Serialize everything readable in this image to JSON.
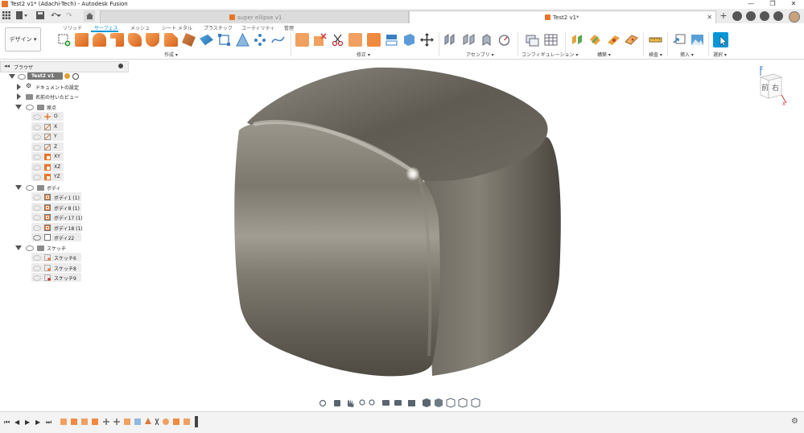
{
  "window": {
    "title": "Test2 v1* (Adachi-Tech) - Autodesk Fusion",
    "controls": [
      "—",
      "❐",
      "✕"
    ]
  },
  "tabs": [
    {
      "label": "super ellipse v1",
      "active": false
    },
    {
      "label": "Test2 v1*",
      "active": true
    }
  ],
  "ribbon": {
    "workspace_label": "デザイン ▾",
    "tabs": [
      "ソリッド",
      "サーフェス",
      "メッシュ",
      "シート メタル",
      "プラスチック",
      "ユーティリティ",
      "管理"
    ],
    "active_tab": "サーフェス",
    "groups": [
      "作成 ▾",
      "修正 ▾",
      "アセンブリ ▾",
      "コンフィギュレーション ▾",
      "構築 ▾",
      "検査 ▾",
      "挿入 ▾",
      "選択 ▾"
    ]
  },
  "browser": {
    "header": "ブラウザ",
    "root": "Test2 v1",
    "items": [
      {
        "label": "ドキュメントの設定"
      },
      {
        "label": "名前の付いたビュー"
      },
      {
        "label": "原点"
      },
      {
        "label": "O"
      },
      {
        "label": "X"
      },
      {
        "label": "Y"
      },
      {
        "label": "Z"
      },
      {
        "label": "XY"
      },
      {
        "label": "XZ"
      },
      {
        "label": "YZ"
      },
      {
        "label": "ボディ"
      },
      {
        "label": "ボディ1 (1)"
      },
      {
        "label": "ボディ8 (1)"
      },
      {
        "label": "ボディ17 (1)"
      },
      {
        "label": "ボディ18 (1)"
      },
      {
        "label": "ボディ22"
      },
      {
        "label": "スケッチ"
      },
      {
        "label": "スケッチ6"
      },
      {
        "label": "スケッチ8"
      },
      {
        "label": "スケッチ9"
      }
    ]
  },
  "viewcube": {
    "front": "前",
    "right": "右",
    "axis_z": "Z",
    "axis_x": "X"
  },
  "colors": {
    "accent": "#0696d7",
    "fusion_orange": "#e8742a",
    "model_gray": "#6e6a60"
  }
}
